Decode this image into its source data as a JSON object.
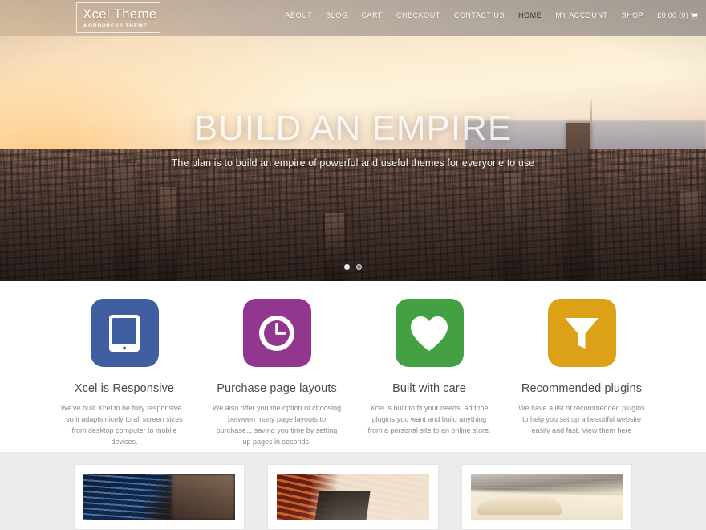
{
  "header": {
    "logo": {
      "title": "Xcel Theme",
      "subtitle": "WORDPRESS THEME"
    },
    "nav_items": [
      {
        "label": "ABOUT",
        "active": false
      },
      {
        "label": "BLOG",
        "active": false
      },
      {
        "label": "CART",
        "active": false
      },
      {
        "label": "CHECKOUT",
        "active": false
      },
      {
        "label": "CONTACT US",
        "active": false
      },
      {
        "label": "HOME",
        "active": true
      },
      {
        "label": "MY ACCOUNT",
        "active": false
      },
      {
        "label": "SHOP",
        "active": false
      }
    ],
    "cart": {
      "label": "£0.00 (0)",
      "icon": "shopping-cart-icon"
    }
  },
  "hero": {
    "title": "BUILD AN EMPIRE",
    "subtitle": "The plan is to build an empire of powerful and useful themes for everyone to use",
    "background": "aerial-city-sunset-photo",
    "slider_dots": [
      {
        "active": true
      },
      {
        "active": false
      }
    ]
  },
  "features": [
    {
      "icon": "tablet-icon",
      "color": "#3f5fa0",
      "title": "Xcel is Responsive",
      "description": "We've built Xcel to be fully responsive... so it adapts nicely to all screen sizes from desktop computer to mobile devices."
    },
    {
      "icon": "clock-icon",
      "color": "#92378f",
      "title": "Purchase page layouts",
      "description": "We also offer you the option of choosing between many page layouts to purchase... saving you time by setting up pages in seconds."
    },
    {
      "icon": "heart-icon",
      "color": "#44a143",
      "title": "Built with care",
      "description": "Xcel is built to fit your needs, add the plugins you want and build anything from a personal site to an online store."
    },
    {
      "icon": "funnel-icon",
      "color": "#dda117",
      "title": "Recommended plugins",
      "description": "We have a list of recommended plugins to help you set up a beautiful website easily and fast. View them here"
    }
  ],
  "cards": [
    {
      "image": "laptop-coding-photo"
    },
    {
      "image": "laptop-graphics-tablet-photo"
    },
    {
      "image": "open-notebook-photo"
    }
  ]
}
